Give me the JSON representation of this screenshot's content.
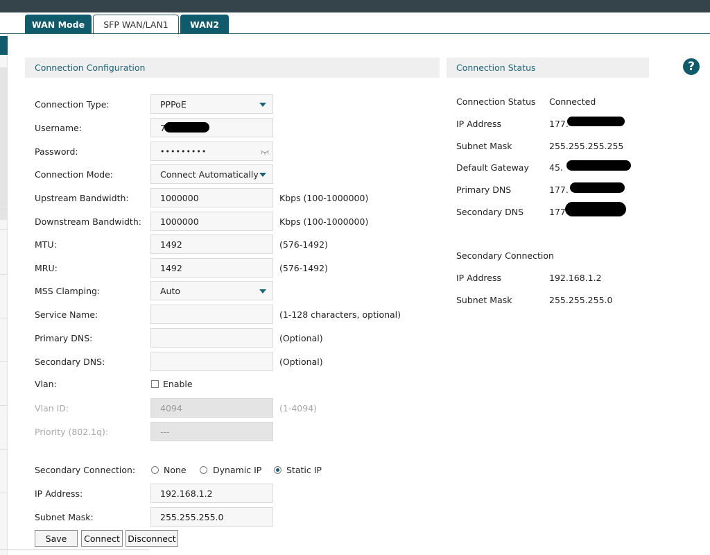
{
  "tabs": [
    "WAN Mode",
    "SFP WAN/LAN1",
    "WAN2"
  ],
  "config": {
    "title": "Connection Configuration",
    "connection_type": {
      "label": "Connection Type:",
      "value": "PPPoE"
    },
    "username": {
      "label": "Username:",
      "value": "7"
    },
    "password": {
      "label": "Password:",
      "value": "•••••••••"
    },
    "connection_mode": {
      "label": "Connection Mode:",
      "value": "Connect Automatically"
    },
    "upstream": {
      "label": "Upstream Bandwidth:",
      "value": "1000000",
      "hint": "Kbps (100-1000000)"
    },
    "downstream": {
      "label": "Downstream Bandwidth:",
      "value": "1000000",
      "hint": "Kbps (100-1000000)"
    },
    "mtu": {
      "label": "MTU:",
      "value": "1492",
      "hint": "(576-1492)"
    },
    "mru": {
      "label": "MRU:",
      "value": "1492",
      "hint": "(576-1492)"
    },
    "mss": {
      "label": "MSS Clamping:",
      "value": "Auto"
    },
    "service_name": {
      "label": "Service Name:",
      "value": "",
      "hint": "(1-128 characters, optional)"
    },
    "primary_dns": {
      "label": "Primary DNS:",
      "value": "",
      "hint": "(Optional)"
    },
    "secondary_dns": {
      "label": "Secondary DNS:",
      "value": "",
      "hint": "(Optional)"
    },
    "vlan": {
      "label": "Vlan:",
      "checkbox_label": "Enable",
      "checked": false
    },
    "vlan_id": {
      "label": "Vlan ID:",
      "value": "4094",
      "hint": "(1-4094)"
    },
    "priority": {
      "label": "Priority (802.1q):",
      "value": "---"
    },
    "secondary_connection": {
      "label": "Secondary Connection:",
      "options": [
        "None",
        "Dynamic IP",
        "Static IP"
      ],
      "selected": "Static IP"
    },
    "sec_ip": {
      "label": "IP Address:",
      "value": "192.168.1.2"
    },
    "sec_mask": {
      "label": "Subnet Mask:",
      "value": "255.255.255.0"
    },
    "buttons": {
      "save": "Save",
      "connect": "Connect",
      "disconnect": "Disconnect"
    }
  },
  "status": {
    "title": "Connection Status",
    "rows": [
      {
        "label": "Connection Status",
        "value": "Connected"
      },
      {
        "label": "IP Address",
        "value": "177."
      },
      {
        "label": "Subnet Mask",
        "value": "255.255.255.255"
      },
      {
        "label": "Default Gateway",
        "value": "45."
      },
      {
        "label": "Primary DNS",
        "value": "177."
      },
      {
        "label": "Secondary DNS",
        "value": "177"
      }
    ],
    "secondary_title": "Secondary Connection",
    "secondary_rows": [
      {
        "label": "IP Address",
        "value": "192.168.1.2"
      },
      {
        "label": "Subnet Mask",
        "value": "255.255.255.0"
      }
    ]
  },
  "help_icon": "question-mark-icon",
  "colors": {
    "accent": "#0f5a6b",
    "header_text": "#1b6377",
    "topbar": "#35444a"
  }
}
